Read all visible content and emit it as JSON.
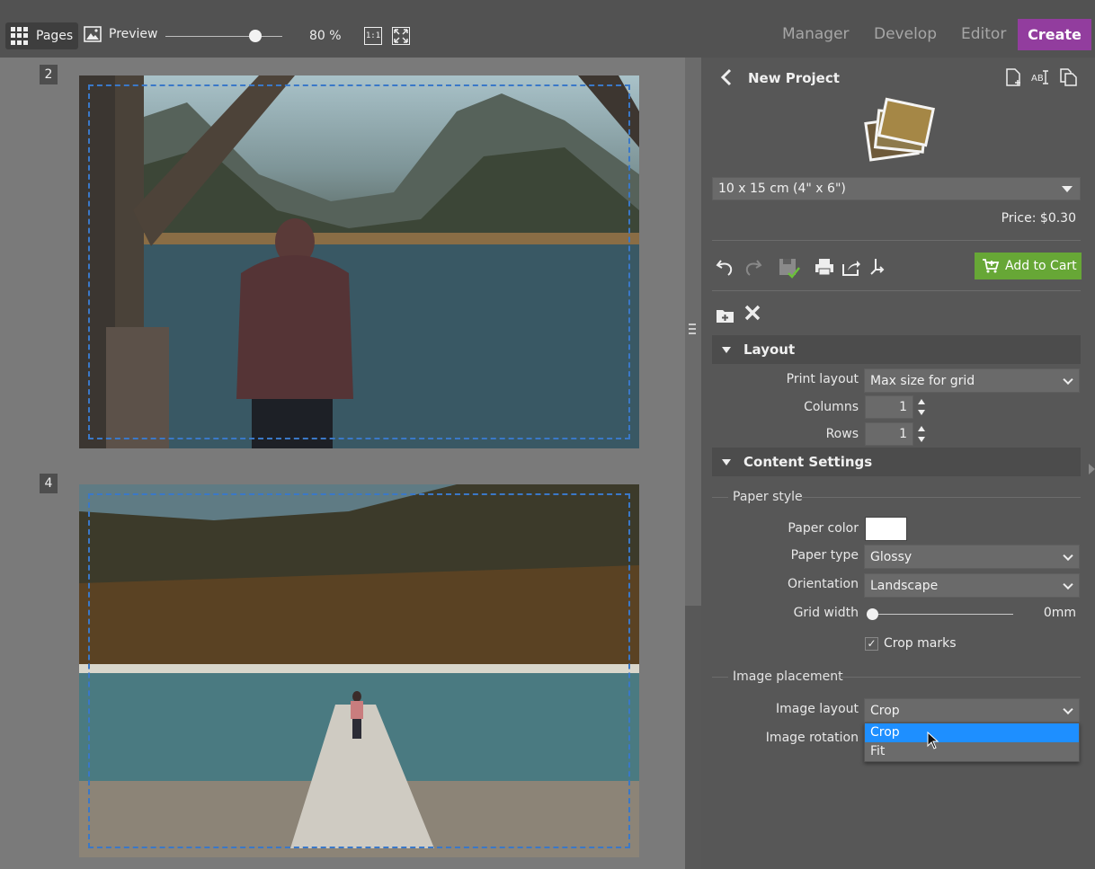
{
  "toolbar": {
    "pages_label": "Pages",
    "preview_label": "Preview",
    "zoom_value": "80 %",
    "zoom_fraction": 0.77,
    "actual_size_label": "1:1",
    "nav": [
      "Manager",
      "Develop",
      "Editor"
    ],
    "create_label": "Create",
    "create_color": "#923d9e"
  },
  "canvas": {
    "pages": [
      {
        "number": "2"
      },
      {
        "number": "4"
      }
    ]
  },
  "panel": {
    "title": "New Project",
    "size_select": "10 x 15 cm (4\" x 6\")",
    "price": "Price: $0.30",
    "add_to_cart": "Add to Cart",
    "cart_color": "#67a736",
    "layout": {
      "header": "Layout",
      "print_layout_label": "Print layout",
      "print_layout_value": "Max size for grid",
      "columns_label": "Columns",
      "columns_value": "1",
      "rows_label": "Rows",
      "rows_value": "1"
    },
    "content": {
      "header": "Content Settings",
      "paper_style": "Paper style",
      "paper_color_label": "Paper color",
      "paper_color": "#ffffff",
      "paper_type_label": "Paper type",
      "paper_type_value": "Glossy",
      "orientation_label": "Orientation",
      "orientation_value": "Landscape",
      "grid_width_label": "Grid width",
      "grid_width_value": "0mm",
      "crop_marks_label": "Crop marks",
      "crop_marks_checked": true,
      "image_placement": "Image placement",
      "image_layout_label": "Image layout",
      "image_layout_value": "Crop",
      "image_rotation_label": "Image rotation",
      "image_layout_options": [
        "Crop",
        "Fit"
      ],
      "highlight_color": "#1e8fff"
    }
  }
}
